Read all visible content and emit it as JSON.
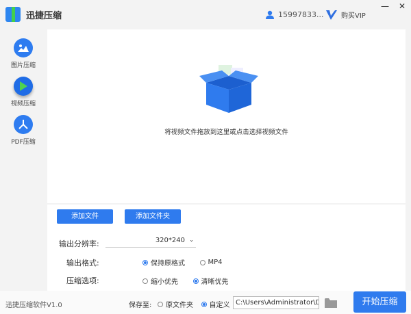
{
  "app": {
    "title": "迅捷压缩",
    "user": "15997833...",
    "vip": "购买VIP",
    "minimize": "—",
    "close": "✕"
  },
  "sidebar": {
    "items": [
      {
        "label": "图片压缩",
        "icon": "image-icon"
      },
      {
        "label": "视频压缩",
        "icon": "play-icon"
      },
      {
        "label": "PDF压缩",
        "icon": "pdf-icon"
      }
    ]
  },
  "drop": {
    "hint": "将视频文件拖放到这里或点击选择视频文件"
  },
  "buttons": {
    "add_file": "添加文件",
    "add_folder": "添加文件夹",
    "start": "开始压缩"
  },
  "settings": {
    "resolution_label": "输出分辨率:",
    "resolution_value": "320*240",
    "format_label": "输出格式:",
    "format_options": [
      "保持原格式",
      "MP4"
    ],
    "format_selected": "保持原格式",
    "compress_label": "压缩选项:",
    "compress_options": [
      "缩小优先",
      "清晰优先"
    ],
    "compress_selected": "清晰优先"
  },
  "footer": {
    "version": "迅捷压缩软件V1.0",
    "save_label": "保存至:",
    "save_options": [
      "原文件夹",
      "自定义"
    ],
    "save_selected": "自定义",
    "path": "C:\\Users\\Administrator\\Desktop"
  },
  "colors": {
    "accent": "#2f7bee"
  }
}
